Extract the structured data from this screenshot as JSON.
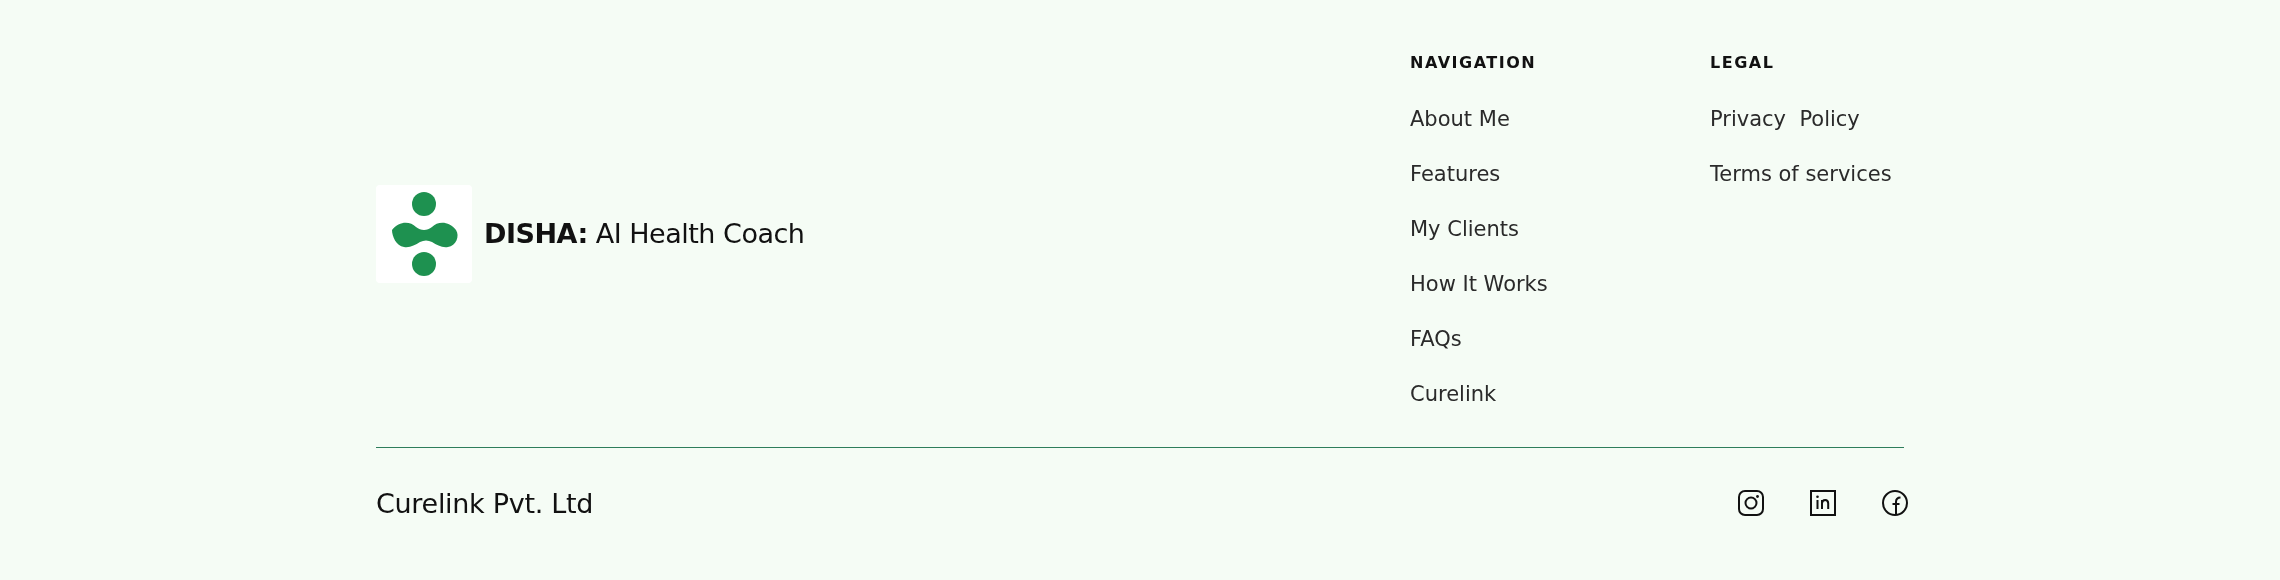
{
  "brand": {
    "name": "**DISHA:** AI Health Coach"
  },
  "columns": [
    {
      "heading": "NAVIGATION",
      "links": [
        "About Me",
        "Features",
        "My Clients",
        "How It Works",
        "FAQs",
        "Curelink"
      ]
    },
    {
      "heading": "LEGAL",
      "links": [
        "Privacy  Policy",
        "Terms of services"
      ]
    }
  ],
  "copyright": "Curelink Pvt. Ltd",
  "social": [
    {
      "kind": "instagram"
    },
    {
      "kind": "linkedin"
    },
    {
      "kind": "facebook"
    }
  ]
}
